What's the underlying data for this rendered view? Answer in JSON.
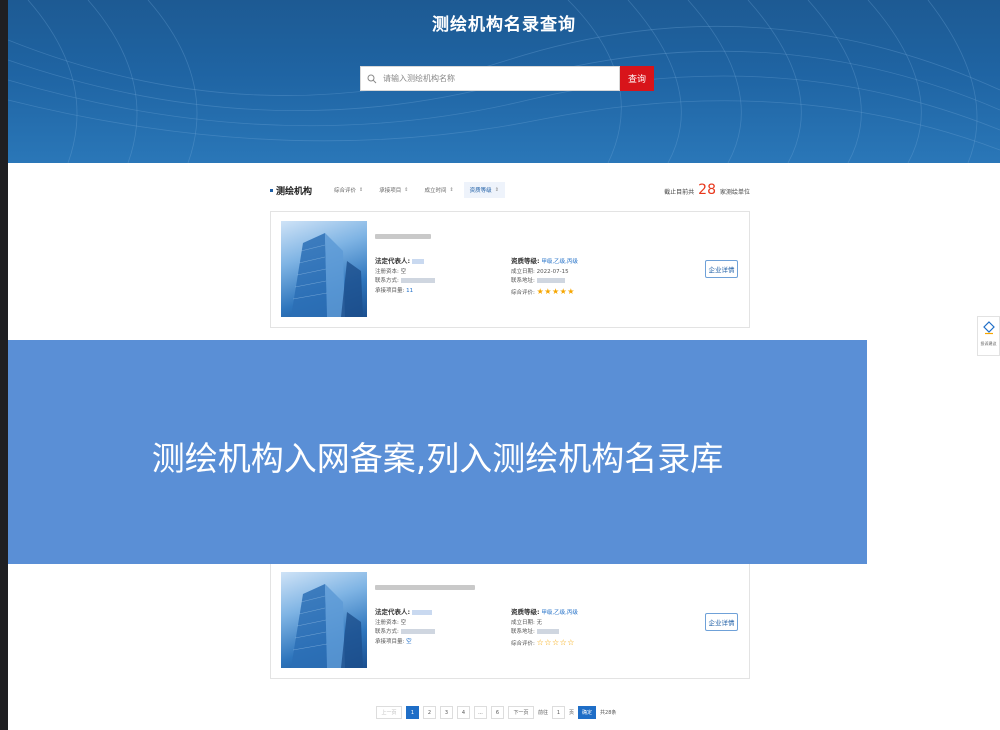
{
  "banner": {
    "title": "测绘机构名录查询",
    "search_placeholder": "请输入测绘机构名称",
    "search_button": "查询"
  },
  "toolbar": {
    "section_title": "测绘机构",
    "sorts": [
      {
        "label": "综合评价",
        "active": false
      },
      {
        "label": "承接项目",
        "active": false
      },
      {
        "label": "成立时间",
        "active": false
      },
      {
        "label": "资质等级",
        "active": true
      }
    ],
    "count_prefix": "截止目前共",
    "count_value": "28",
    "count_suffix": "家测绘单位"
  },
  "cards": [
    {
      "legal_rep_label": "法定代表人:",
      "capital_label": "注册资本:",
      "capital_value": "空",
      "contact_label": "联系方式:",
      "projects_label": "承接项目量:",
      "projects_value": "11",
      "qual_label": "资质等级:",
      "qual_value": "甲级,乙级,丙级",
      "date_label": "成立日期:",
      "date_value": "2022-07-15",
      "address_label": "联系地址:",
      "rating_label": "综合评价:",
      "rating_stars": "★★★★★",
      "detail_button": "企业详情"
    },
    {
      "legal_rep_label": "法定代表人:",
      "capital_label": "注册资本:",
      "capital_value": "空",
      "contact_label": "联系方式:",
      "projects_label": "承接项目量:",
      "projects_value": "空",
      "qual_label": "资质等级:",
      "qual_value": "甲级,乙级,丙级",
      "date_label": "成立日期:",
      "date_value": "无",
      "address_label": "联系地址:",
      "rating_label": "综合评价:",
      "rating_stars": "☆☆☆☆☆",
      "detail_button": "企业详情"
    }
  ],
  "pagination": {
    "prev": "上一页",
    "pages": [
      "1",
      "2",
      "3",
      "4",
      "...",
      "6"
    ],
    "next": "下一页",
    "goto_label": "前往",
    "goto_value": "1",
    "page_unit": "页",
    "confirm": "确定",
    "total": "共28条"
  },
  "overlay": {
    "text": "测绘机构入网备案,列入测绘机构名录库"
  },
  "feedback": {
    "label": "投诉建议"
  }
}
